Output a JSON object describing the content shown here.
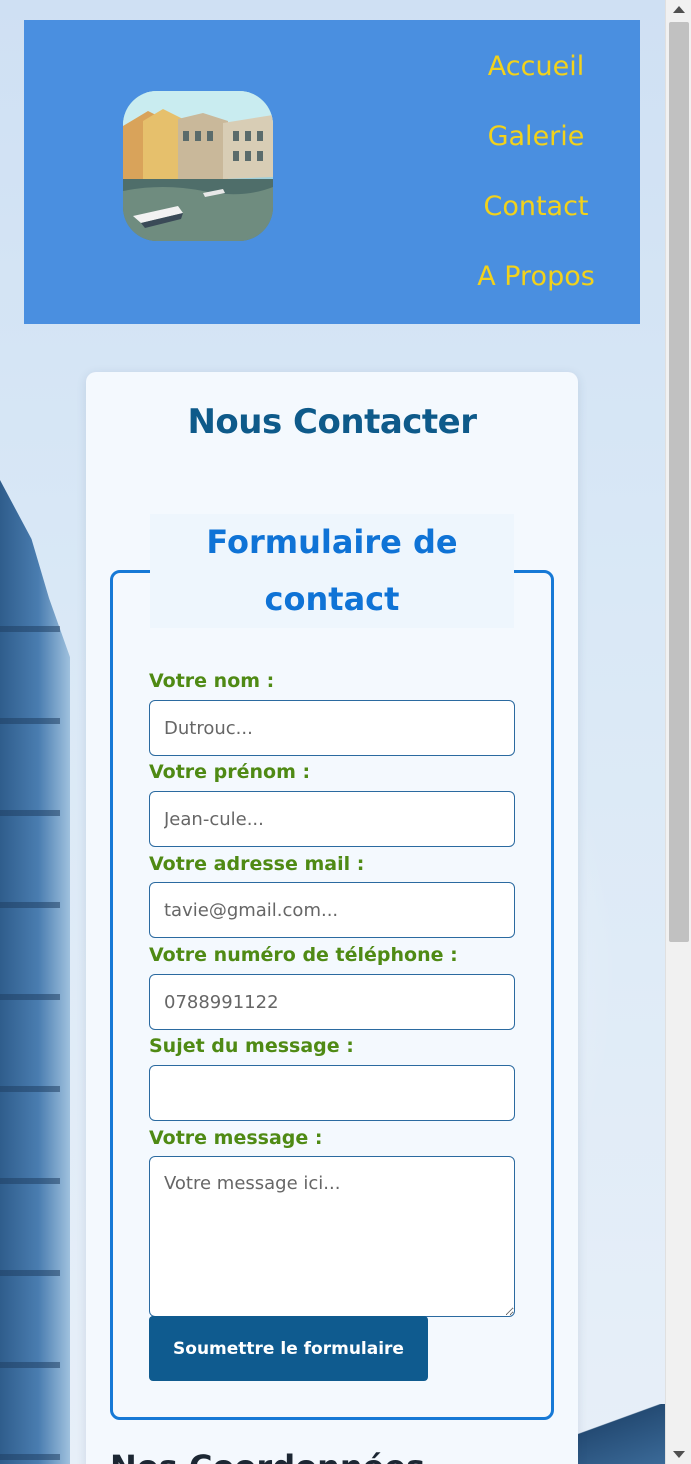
{
  "header": {
    "nav": [
      {
        "label": "Accueil"
      },
      {
        "label": "Galerie"
      },
      {
        "label": "Contact"
      },
      {
        "label": "A Propos"
      }
    ]
  },
  "card": {
    "title": "Nous Contacter",
    "form": {
      "legend": "Formulaire de contact",
      "fields": [
        {
          "label": "Votre nom :",
          "placeholder": "Dutrouc..."
        },
        {
          "label": "Votre prénom :",
          "placeholder": "Jean-cule..."
        },
        {
          "label": "Votre adresse mail :",
          "placeholder": "tavie@gmail.com..."
        },
        {
          "label": "Votre numéro de téléphone :",
          "placeholder": "0788991122"
        },
        {
          "label": "Sujet du message :",
          "placeholder": ""
        },
        {
          "label": "Votre message :",
          "placeholder": "Votre message ici..."
        }
      ],
      "submit_label": "Soumettre le formulaire"
    },
    "next_section_heading": "Nos Coordonnées"
  },
  "colors": {
    "header_bg": "#4a8fe0",
    "nav_text": "#f2d21b",
    "title": "#0e5a8a",
    "legend": "#0f73d6",
    "label": "#4f8a14",
    "button_bg": "#0f5b8f"
  }
}
